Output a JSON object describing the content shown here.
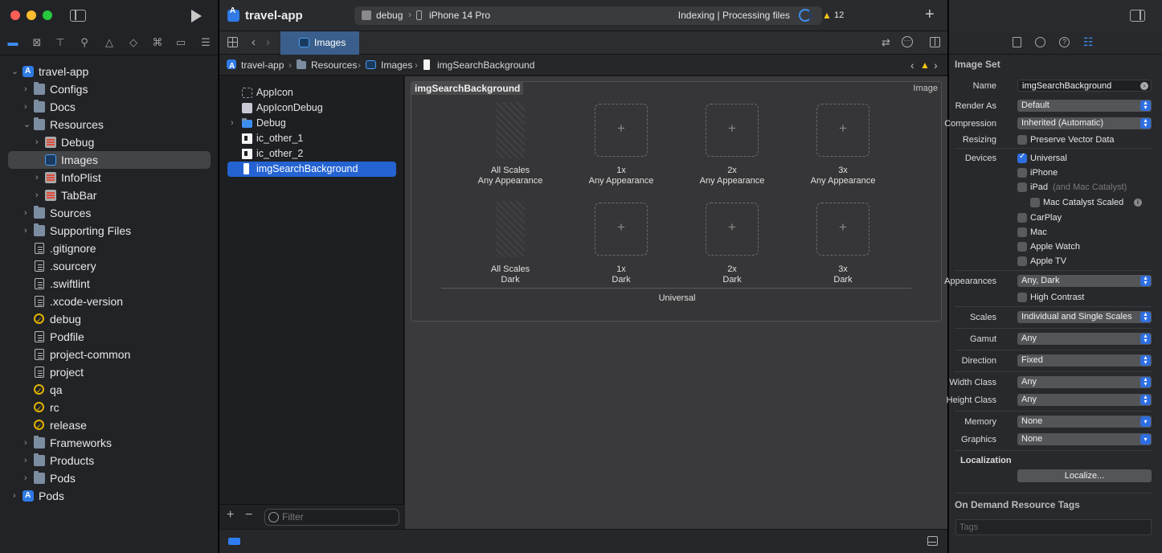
{
  "project": {
    "name": "travel-app"
  },
  "navigator": {
    "filter_placeholder": "Filter",
    "items": [
      {
        "label": "travel-app"
      },
      {
        "label": "Configs"
      },
      {
        "label": "Docs"
      },
      {
        "label": "Resources"
      },
      {
        "label": "Debug"
      },
      {
        "label": "Images"
      },
      {
        "label": "InfoPlist"
      },
      {
        "label": "TabBar"
      },
      {
        "label": "Sources"
      },
      {
        "label": "Supporting Files"
      },
      {
        "label": ".gitignore"
      },
      {
        "label": ".sourcery"
      },
      {
        "label": ".swiftlint"
      },
      {
        "label": ".xcode-version"
      },
      {
        "label": "debug"
      },
      {
        "label": "Podfile"
      },
      {
        "label": "project-common"
      },
      {
        "label": "project"
      },
      {
        "label": "qa"
      },
      {
        "label": "rc"
      },
      {
        "label": "release"
      },
      {
        "label": "Frameworks"
      },
      {
        "label": "Products"
      },
      {
        "label": "Pods"
      },
      {
        "label": "Pods"
      }
    ]
  },
  "toolbar": {
    "scheme": "debug",
    "device": "iPhone 14 Pro",
    "status": "Indexing | Processing files",
    "warnings": "12"
  },
  "tabs": [
    {
      "label": "Images"
    }
  ],
  "jumpbar": [
    "travel-app",
    "Resources",
    "Images",
    "imgSearchBackground"
  ],
  "asset_list": [
    {
      "label": "AppIcon"
    },
    {
      "label": "AppIconDebug"
    },
    {
      "label": "Debug"
    },
    {
      "label": "ic_other_1"
    },
    {
      "label": "ic_other_2"
    },
    {
      "label": "imgSearchBackground"
    }
  ],
  "image_set": {
    "name": "imgSearchBackground",
    "kind": "Image",
    "row1": [
      {
        "scale": "All Scales",
        "appearance": "Any Appearance"
      },
      {
        "scale": "1x",
        "appearance": "Any Appearance"
      },
      {
        "scale": "2x",
        "appearance": "Any Appearance"
      },
      {
        "scale": "3x",
        "appearance": "Any Appearance"
      }
    ],
    "row2": [
      {
        "scale": "All Scales",
        "appearance": "Dark"
      },
      {
        "scale": "1x",
        "appearance": "Dark"
      },
      {
        "scale": "2x",
        "appearance": "Dark"
      },
      {
        "scale": "3x",
        "appearance": "Dark"
      }
    ],
    "footer": "Universal"
  },
  "inspector": {
    "section_title": "Image Set",
    "name_label": "Name",
    "name_value": "imgSearchBackground",
    "render_as_label": "Render As",
    "render_as": "Default",
    "compression_label": "Compression",
    "compression": "Inherited (Automatic)",
    "resizing_label": "Resizing",
    "preserve_vector": "Preserve Vector Data",
    "devices_label": "Devices",
    "devices": {
      "universal": "Universal",
      "iphone": "iPhone",
      "ipad": "iPad",
      "ipad_note": "(and Mac Catalyst)",
      "mac_catalyst_scaled": "Mac Catalyst Scaled",
      "carplay": "CarPlay",
      "mac": "Mac",
      "apple_watch": "Apple Watch",
      "apple_tv": "Apple TV"
    },
    "appearances_label": "Appearances",
    "appearances": "Any, Dark",
    "high_contrast": "High Contrast",
    "scales_label": "Scales",
    "scales": "Individual and Single Scales",
    "gamut_label": "Gamut",
    "gamut": "Any",
    "direction_label": "Direction",
    "direction": "Fixed",
    "width_class_label": "Width Class",
    "width_class": "Any",
    "height_class_label": "Height Class",
    "height_class": "Any",
    "memory_label": "Memory",
    "memory": "None",
    "graphics_label": "Graphics",
    "graphics": "None",
    "localization_label": "Localization",
    "localize_button": "Localize...",
    "odr_title": "On Demand Resource Tags",
    "tags_placeholder": "Tags"
  },
  "colors": {
    "accent": "#2463d1",
    "warning": "#f5c518"
  }
}
